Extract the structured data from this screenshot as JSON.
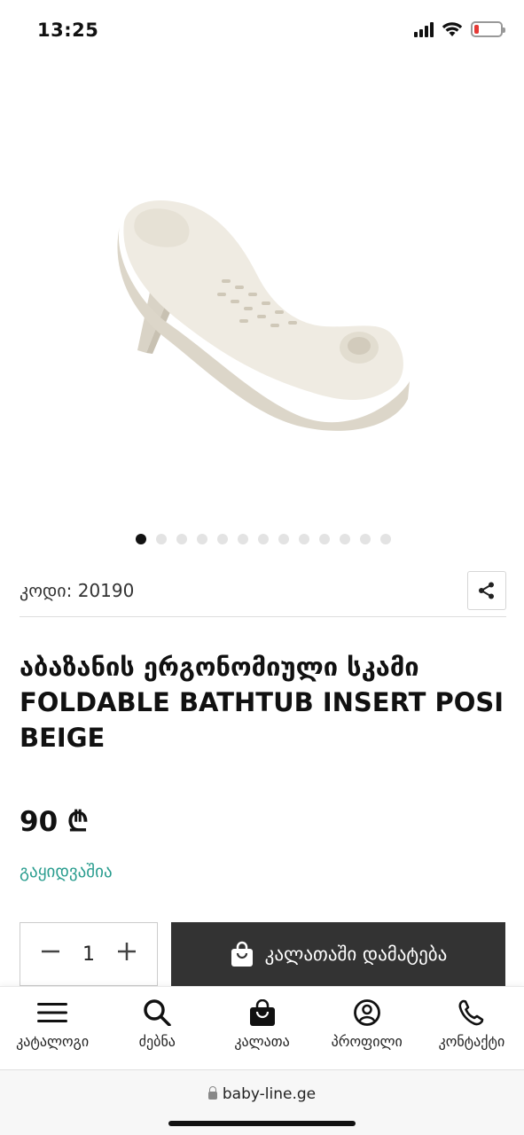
{
  "status_bar": {
    "time": "13:25"
  },
  "carousel": {
    "dot_count": 13,
    "active_index": 0
  },
  "product": {
    "code_label": "კოდი: 20190",
    "title": "აბაზანის ერგონომიული სკამი FOLDABLE BATHTUB INSERT POSI BEIGE",
    "price": "90 ₾",
    "availability": "გაყიდვაშია",
    "quantity": "1",
    "add_to_cart_label": "კალათაში დამატება"
  },
  "bottom_nav": {
    "items": [
      {
        "label": "კატალოგი",
        "icon": "menu-icon"
      },
      {
        "label": "ძებნა",
        "icon": "search-icon"
      },
      {
        "label": "კალათა",
        "icon": "bag-icon"
      },
      {
        "label": "პროფილი",
        "icon": "profile-icon"
      },
      {
        "label": "კონტაქტი",
        "icon": "phone-icon"
      }
    ]
  },
  "browser": {
    "url": "baby-line.ge"
  },
  "colors": {
    "availability": "#2a9d8f",
    "cart_button": "#333333",
    "product_cream": "#eeeae0"
  }
}
